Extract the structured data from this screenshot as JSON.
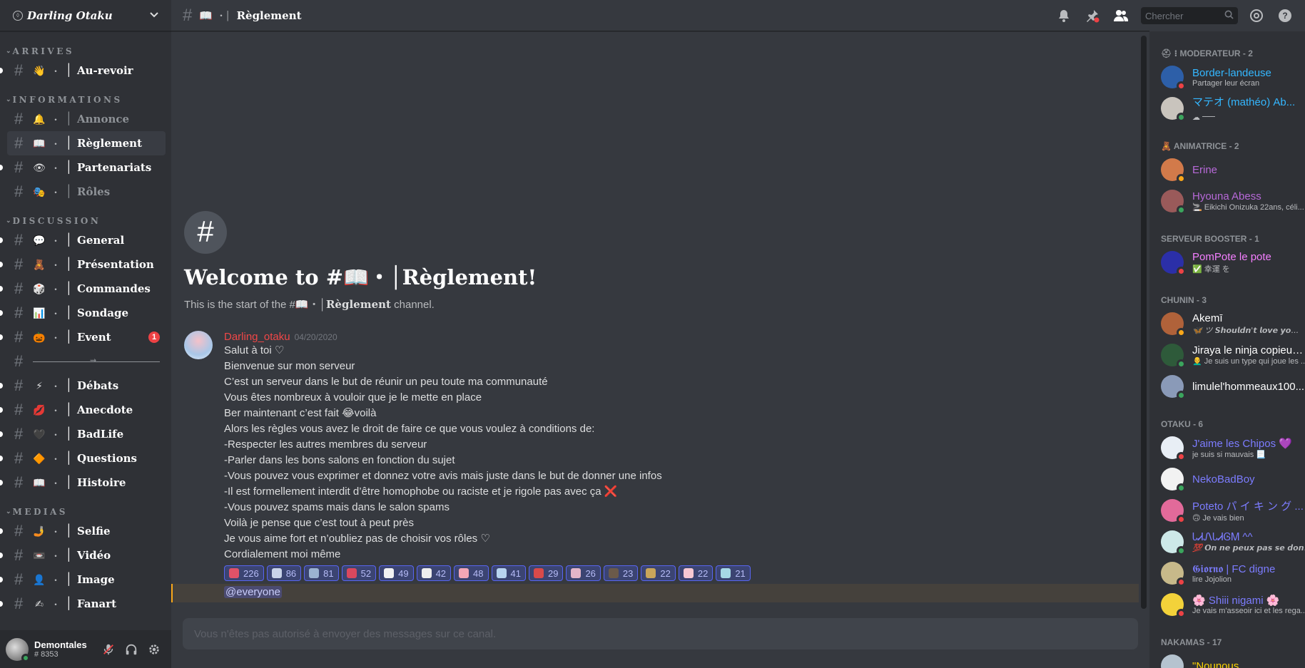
{
  "guild": {
    "name": "Darling Otaku"
  },
  "categories": {
    "arrives": "ARRIVES",
    "informations": "INFORMATIONS",
    "discussion": "DISCUSSION",
    "medias": "MEDIAS"
  },
  "channels": {
    "aurevoir": {
      "emoji": "👋",
      "name": "Au-revoir"
    },
    "annonce": {
      "emoji": "🔔",
      "name": "Annonce"
    },
    "reglement": {
      "emoji": "📖",
      "name": "Règlement"
    },
    "partenariats": {
      "emoji": "👁",
      "name": "Partenariats"
    },
    "roles": {
      "emoji": "🎭",
      "name": "Rôles"
    },
    "general": {
      "emoji": "💬",
      "name": "General"
    },
    "presentation": {
      "emoji": "🧸",
      "name": "Présentation"
    },
    "commandes": {
      "emoji": "🎲",
      "name": "Commandes"
    },
    "sondage": {
      "emoji": "📊",
      "name": "Sondage"
    },
    "event": {
      "emoji": "🎃",
      "name": "Event",
      "badge": "1"
    },
    "debats": {
      "emoji": "⚡",
      "name": "Débats"
    },
    "anecdote": {
      "emoji": "💋",
      "name": "Anecdote"
    },
    "badlife": {
      "emoji": "🖤",
      "name": "BadLife"
    },
    "questions": {
      "emoji": "🔶",
      "name": "Questions"
    },
    "histoire": {
      "emoji": "📖",
      "name": "Histoire"
    },
    "selfie": {
      "emoji": "🤳",
      "name": "Selfie"
    },
    "video": {
      "emoji": "📼",
      "name": "Vidéo"
    },
    "image": {
      "emoji": "👤",
      "name": "Image"
    },
    "fanart": {
      "emoji": "✍",
      "name": "Fanart"
    }
  },
  "user": {
    "name": "Demontales",
    "tag": "# 8353"
  },
  "topbar": {
    "channel_emoji": "📖",
    "channel_name": "Règlement",
    "search_placeholder": "Chercher"
  },
  "welcome": {
    "title": "Welcome to #📖・│Règlement!",
    "sub_prefix": "This is the start of the #📖・│",
    "sub_channel": "Règlement",
    "sub_suffix": " channel."
  },
  "message": {
    "author": "Darling_otaku",
    "timestamp": "04/20/2020",
    "lines": [
      "Salut à toi ♡",
      "Bienvenue sur mon serveur",
      "C’est un serveur dans le but de réunir un peu toute ma communauté",
      "Vous êtes nombreux à vouloir que je le mette en place",
      "Ber maintenant c’est fait 😂voilà",
      "Alors les règles vous avez le droit de faire ce que vous voulez à conditions de:",
      "-Respecter les autres membres du serveur",
      "-Parler dans les bons salons en fonction du sujet",
      "-Vous pouvez vous exprimer et donnez votre avis mais juste dans le but de donner une infos",
      "-Il est formellement interdit d’être homophobe ou raciste et je rigole pas avec ça ❌",
      "-Vous pouvez spams mais dans le salon spams",
      "Voilà je pense que c’est tout à peut près",
      "Je vous aime fort et n’oubliez pas de choisir vos rôles ♡",
      "Cordialement moi même"
    ],
    "reactions": [
      {
        "count": "226",
        "color": "#e05268"
      },
      {
        "count": "86",
        "color": "#c9d3e8"
      },
      {
        "count": "81",
        "color": "#9bb3d1"
      },
      {
        "count": "52",
        "color": "#d9485e"
      },
      {
        "count": "49",
        "color": "#f2f2f2"
      },
      {
        "count": "42",
        "color": "#eeeeee"
      },
      {
        "count": "48",
        "color": "#f3a7b6"
      },
      {
        "count": "41",
        "color": "#b8d4f0"
      },
      {
        "count": "29",
        "color": "#d94a4a"
      },
      {
        "count": "26",
        "color": "#e3b5c8"
      },
      {
        "count": "23",
        "color": "#6b5a4a"
      },
      {
        "count": "22",
        "color": "#c9a55a"
      },
      {
        "count": "22",
        "color": "#f6c8d2"
      },
      {
        "count": "21",
        "color": "#a6d9e6"
      }
    ],
    "mention": "@everyone"
  },
  "composer": {
    "placeholder": "Vous n'êtes pas autorisé à envoyer des messages sur ce canal."
  },
  "members": {
    "moderateur": {
      "label": "⛑ ⁝ MODERATEUR - 2",
      "list": [
        {
          "name": "Border-landeuse",
          "status": "Partager leur écran",
          "color": "#34b7ff",
          "presence": "dnd",
          "avatar": "#2d5fa8"
        },
        {
          "name": "マテオ (mathéo) Ab...",
          "status": "☁ ᠆᠆᠆᠆",
          "color": "#34b7ff",
          "presence": "online",
          "avatar": "#c9c4bd"
        }
      ]
    },
    "animatrice": {
      "label": "🧸 ANIMATRICE - 2",
      "list": [
        {
          "name": "Erine",
          "status": "",
          "color": "#b769d8",
          "presence": "idle",
          "avatar": "#d27a4a"
        },
        {
          "name": "Hyouna Abess",
          "status": "🚬 Eikichi Onizuka 22ans, céli...",
          "color": "#b769d8",
          "presence": "online",
          "avatar": "#9a5a5a"
        }
      ]
    },
    "booster": {
      "label": "SERVEUR BOOSTER - 1",
      "list": [
        {
          "name": "PomPote le pote",
          "status": "✅ 幸運 を",
          "color": "#f47fff",
          "presence": "dnd",
          "avatar": "#2b2fa8"
        }
      ]
    },
    "chunin": {
      "label": "CHUNIN - 3",
      "list": [
        {
          "name": "Akemī",
          "status": "🦋 ツ 𝙎𝙝𝙤𝙪𝙡𝙙𝙣'𝙩 𝙡𝙤𝙫𝙚 𝙮𝙤...",
          "color": "#ffffff",
          "presence": "idle",
          "avatar": "#b0623a",
          "italic": true
        },
        {
          "name": "Jiraya le ninja copieur ...",
          "status": "👨‍🦲 Je suis un type qui joue les ...",
          "color": "#ffffff",
          "presence": "online",
          "avatar": "#2e5a3a"
        },
        {
          "name": "limulel'hommeaux100...",
          "status": "",
          "color": "#ffffff",
          "presence": "online",
          "avatar": "#8a9ab8"
        }
      ]
    },
    "otaku": {
      "label": "OTAKU - 6",
      "list": [
        {
          "name": "J'aime les Chipos 💜",
          "status": "je suis si mauvais 📃",
          "color": "#7c7cff",
          "presence": "dnd",
          "avatar": "#e8eef5"
        },
        {
          "name": "NekoBadBoy",
          "status": "",
          "color": "#7c7cff",
          "presence": "online",
          "avatar": "#f2f2f2"
        },
        {
          "name": "Poteto パ イ キ ン グ ...",
          "status": "🙃 Je vais bien",
          "color": "#7c7cff",
          "presence": "dnd",
          "avatar": "#e26a9a"
        },
        {
          "name": "ᏓᏗᏁᏓᏗᎶᎷ ^^",
          "status": "💯 𝙊𝙣 𝙣𝙚 𝙥𝙚𝙪𝙭 𝙥𝙖𝙨 𝙨𝙚 𝙙𝙤𝙣...",
          "color": "#7c7cff",
          "presence": "online",
          "avatar": "#cde8e8",
          "italic": true
        },
        {
          "name": "𝕲𝖎𝖔𝖗𝖓𝖔 | FC digne",
          "status": "lire Jojolion",
          "color": "#7c7cff",
          "presence": "dnd",
          "avatar": "#c7b98a"
        },
        {
          "name": "🌸 Shiii nigami 🌸",
          "status": "Je vais m'asseoir ici et les rega...",
          "color": "#7c7cff",
          "presence": "dnd",
          "avatar": "#f3d23a"
        }
      ]
    },
    "nakamas": {
      "label": "NAKAMAS - 17",
      "list": [
        {
          "name": "\"Nounous",
          "status": "",
          "color": "#ffd500",
          "presence": "online",
          "avatar": "#b5c3cf"
        }
      ]
    }
  },
  "colors": {
    "accent": "#5865f2",
    "mention_bar": "#faa81a",
    "author": "#f04747"
  }
}
